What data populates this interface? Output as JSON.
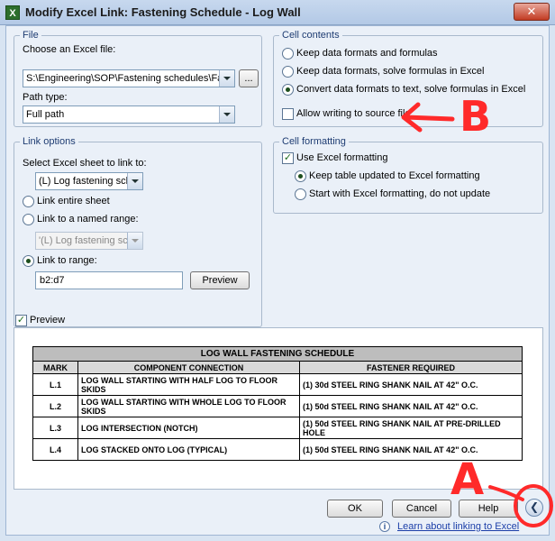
{
  "window": {
    "title": "Modify Excel Link: Fastening Schedule - Log Wall",
    "close_glyph": "✕"
  },
  "file_group": {
    "legend": "File",
    "choose_label": "Choose an Excel file:",
    "file_path": "S:\\Engineering\\SOP\\Fastening schedules\\Fastenir",
    "browse_label": "...",
    "path_type_label": "Path type:",
    "path_type_value": "Full path"
  },
  "link_options": {
    "legend": "Link options",
    "sheet_label": "Select Excel sheet to link to:",
    "sheet_value": "(L) Log fastening sch.",
    "entire_sheet": "Link entire sheet",
    "named_range": "Link to a named range:",
    "named_range_value": "'(L) Log fastening sch.'!",
    "link_range": "Link to range:",
    "range_value": "b2:d7",
    "preview_button": "Preview"
  },
  "cell_contents": {
    "legend": "Cell contents",
    "options": [
      "Keep data formats and formulas",
      "Keep data formats, solve formulas in Excel",
      "Convert data formats to text, solve formulas in Excel"
    ],
    "allow_writing": "Allow writing to source file"
  },
  "cell_formatting": {
    "legend": "Cell formatting",
    "use_excel": "Use Excel formatting",
    "keep_updated": "Keep table updated to Excel formatting",
    "start_with": "Start with Excel formatting, do not update"
  },
  "preview": {
    "label": "Preview",
    "table_title": "LOG WALL FASTENING SCHEDULE",
    "headers": [
      "MARK",
      "COMPONENT CONNECTION",
      "FASTENER REQUIRED"
    ],
    "rows": [
      [
        "L.1",
        "LOG WALL STARTING WITH HALF LOG TO FLOOR SKIDS",
        "(1) 30d STEEL RING SHANK NAIL AT 42\" O.C."
      ],
      [
        "L.2",
        "LOG WALL STARTING WITH WHOLE LOG TO FLOOR SKIDS",
        "(1) 50d STEEL RING SHANK NAIL AT 42\" O.C."
      ],
      [
        "L.3",
        "LOG INTERSECTION (NOTCH)",
        "(1) 50d STEEL RING SHANK NAIL AT PRE-DRILLED HOLE"
      ],
      [
        "L.4",
        "LOG STACKED ONTO LOG (TYPICAL)",
        "(1) 50d STEEL RING SHANK NAIL AT 42\" O.C."
      ]
    ]
  },
  "buttons": {
    "ok": "OK",
    "cancel": "Cancel",
    "help": "Help",
    "expand_glyph": "❮"
  },
  "learn_link": "Learn about linking to Excel",
  "annotations": {
    "a": "A",
    "b": "B",
    "color": "#ff2a2a"
  }
}
